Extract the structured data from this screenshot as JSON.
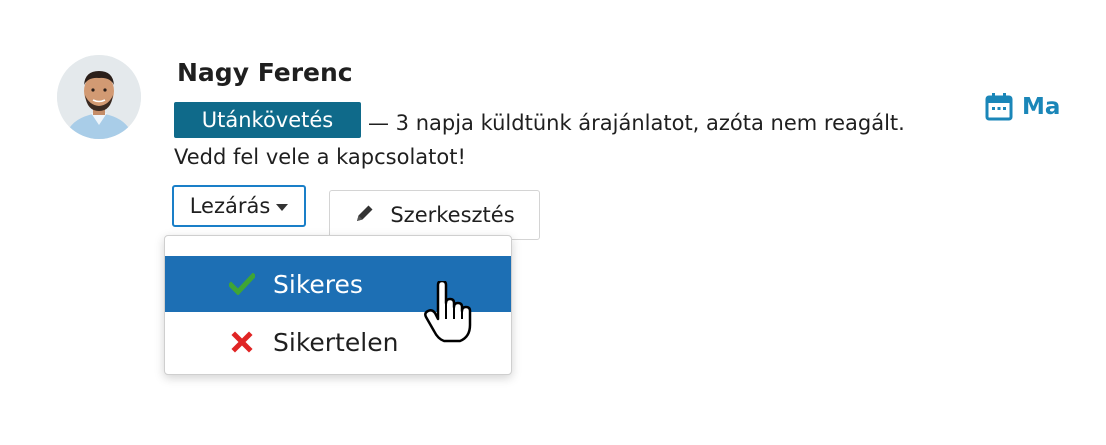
{
  "contact": {
    "name": "Nagy Ferenc",
    "badge": "Utánkövetés",
    "message_line1": "— 3 napja küldtünk árajánlatot, azóta nem reagált.",
    "message_line2": "Vedd fel vele a kapcsolatot!"
  },
  "due": {
    "icon": "calendar-icon",
    "label": "Ma"
  },
  "actions": {
    "close_label": "Lezárás",
    "edit_label": "Szerkesztés",
    "edit_icon": "pencil-icon"
  },
  "dropdown": {
    "items": [
      {
        "label": "Sikeres",
        "icon": "check-icon",
        "state": "hovered"
      },
      {
        "label": "Sikertelen",
        "icon": "x-icon"
      }
    ]
  },
  "colors": {
    "badge_bg": "#0f6a8a",
    "accent": "#1a86b8",
    "menu_highlight": "#1d6fb4",
    "success": "#3fa535",
    "danger": "#e02424"
  }
}
